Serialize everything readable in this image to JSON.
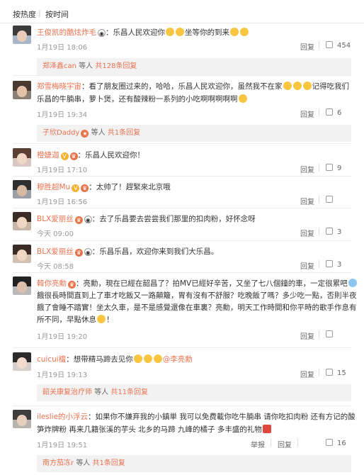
{
  "sort": {
    "hot": "按热度",
    "time": "按时间"
  },
  "comments": [
    {
      "user": "王俊凯的酷炫炸毛",
      "lines": [
        "乐昌人民欢迎你",
        "坐等你的到来"
      ],
      "time": "1月19日 18:06",
      "reply": "回复",
      "likes": "454",
      "thread": {
        "who": "郑泽鑫can",
        "text": "等人",
        "count": "共128条回复"
      }
    },
    {
      "user": "郑雪梅晓宇宙",
      "lines": [
        "：看了朋友圈过来的，哈哈，乐昌人民欢迎你，虽然我不在家",
        "记得吃我们",
        "乐昌的牛腩串，萝卜煲，还有酸辣粉一系列的小吃啊啊啊啊啊"
      ],
      "time": "1月19日 19:34",
      "reply": "回复",
      "likes": "6",
      "thread": {
        "who": "子欣Daddy",
        "text": "等人",
        "count": "共1条回复"
      }
    },
    {
      "user": "橙婕迦",
      "lines": [
        "：乐昌人民欢迎你！"
      ],
      "time": "1月19日 17:10",
      "reply": "回复",
      "likes": "9"
    },
    {
      "user": "穆胜超Mu",
      "lines": [
        "：太帅了！趕緊來北京哦"
      ],
      "time": "1月19日 16:56",
      "reply": "回复",
      "likes": ""
    },
    {
      "user": "BLX爱丽丝",
      "lines": [
        "：去了乐昌要去尝尝我们那里的扣肉粉，好怀念呀"
      ],
      "time": "今天 09:00",
      "reply": "回复",
      "likes": "3"
    },
    {
      "user": "BLX爱丽丝",
      "lines": [
        "：乐昌乐昌，欢迎你来到我们大乐昌。"
      ],
      "time": "今天 08:58",
      "reply": "回复",
      "likes": "3"
    },
    {
      "user": "韓你亮勳",
      "lines": [
        "：亮勳，現在已經在韶昌了？拍MV已經好辛苦，又坐了七八個鐘的車，一定很累吧",
        "餓很長時間直到上了車才吃飯又一路顛簸，胃有沒有不舒服？吃晚飯了嗎？多少吃一點，否則半夜",
        "餓了會睡不踏實！坐太久車，是不是感覺還像在車裏？亮勳，明天工作時間和你平時的歌手作息有",
        "所不同，早點休息",
        "！"
      ],
      "time": "1月19日 19:20",
      "reply": "回复",
      "likes": ""
    },
    {
      "user": "cuicui檀",
      "lines": [
        "：想带精马蹄去见你",
        "@李亮勳"
      ],
      "time": "1月19日 19:13",
      "reply": "回复",
      "likes": "15",
      "thread": {
        "who": "韶关康复治疗师",
        "text": "等人",
        "count": "共11条回复"
      }
    },
    {
      "user": "ileslie的小浮云",
      "lines": [
        "：如果你不嫌弃我的小鎮単 我可以免费載你吃牛腩串 请你吃扣肉粉 还有方记的酸",
        "笋炸牌粉 再来几籍张溪的芋头 北乡的马蹄 九峰的橘子 多丰盛的礼物"
      ],
      "time": "1月19日 19:51",
      "report": "举报",
      "reply": "回复",
      "likes": "16",
      "thread": {
        "who": "南方茄冻r",
        "text": "等人",
        "count": "共1条回复"
      }
    }
  ],
  "colors": {
    "username": "#eb7350",
    "meta": "#999999",
    "thread_bg": "#f2f2f2"
  },
  "icons": [
    "panda-icon",
    "vip-badge-icon",
    "verified-badge-icon",
    "thumbs-up-icon",
    "smile-emoji-icon",
    "gift-icon"
  ]
}
